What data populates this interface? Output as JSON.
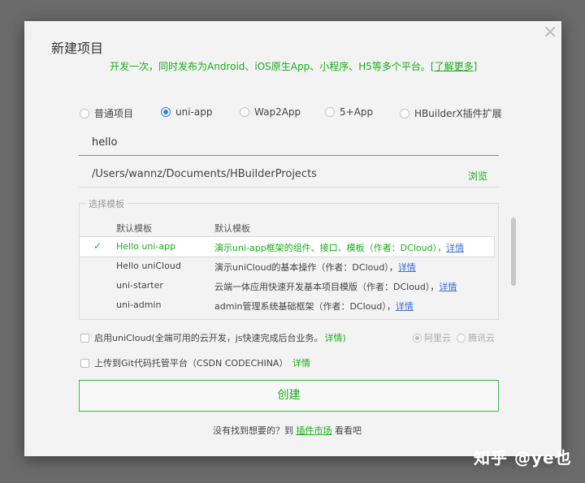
{
  "dialog": {
    "title": "新建项目",
    "subtitle_text": "开发一次，同时发布为Android、iOS原生App、小程序、H5等多个平台。",
    "subtitle_link": "[了解更多]",
    "close_icon": "close-icon"
  },
  "project_types": [
    {
      "label": "普通项目",
      "checked": false
    },
    {
      "label": "uni-app",
      "checked": true
    },
    {
      "label": "Wap2App",
      "checked": false
    },
    {
      "label": "5+App",
      "checked": false
    },
    {
      "label": "HBuilderX插件扩展",
      "checked": false
    }
  ],
  "project_name": {
    "value": "hello"
  },
  "project_path": {
    "value": "/Users/wannz/Documents/HBuilderProjects",
    "browse_label": "浏览"
  },
  "templates": {
    "legend": "选择模板",
    "header": {
      "name": "默认模板",
      "desc": "默认模板"
    },
    "rows": [
      {
        "name": "Hello uni-app",
        "desc": "演示uni-app框架的组件、接口、模板（作者：DCloud），",
        "link": "详情",
        "selected": true
      },
      {
        "name": "Hello uniCloud",
        "desc": "演示uniCloud的基本操作（作者：DCloud），",
        "link": "详情",
        "selected": false
      },
      {
        "name": "uni-starter",
        "desc": "云端一体应用快速开发基本项目模版（作者：DCloud），",
        "link": "详情",
        "selected": false
      },
      {
        "name": "uni-admin",
        "desc": "admin管理系统基础框架（作者：DCloud），",
        "link": "详情",
        "selected": false
      }
    ],
    "check_icon": "✓"
  },
  "options": {
    "unicloud": {
      "label": "启用uniCloud(全端可用的云开发，js快速完成后台业务。",
      "link": "详情)"
    },
    "git": {
      "label": "上传到Git代码托管平台（CSDN CODECHINA）",
      "link": "详情"
    },
    "vendors": [
      {
        "label": "阿里云",
        "checked": true
      },
      {
        "label": "腾讯云",
        "checked": false
      }
    ]
  },
  "create_button": {
    "label": "创建"
  },
  "footer": {
    "prefix": "没有找到想要的？到",
    "link": "插件市场",
    "suffix": "看看吧"
  },
  "watermark": "知乎 @ye也",
  "colors": {
    "accent": "#1aad19",
    "radio": "#3478f6",
    "link": "#3a6fd8"
  }
}
